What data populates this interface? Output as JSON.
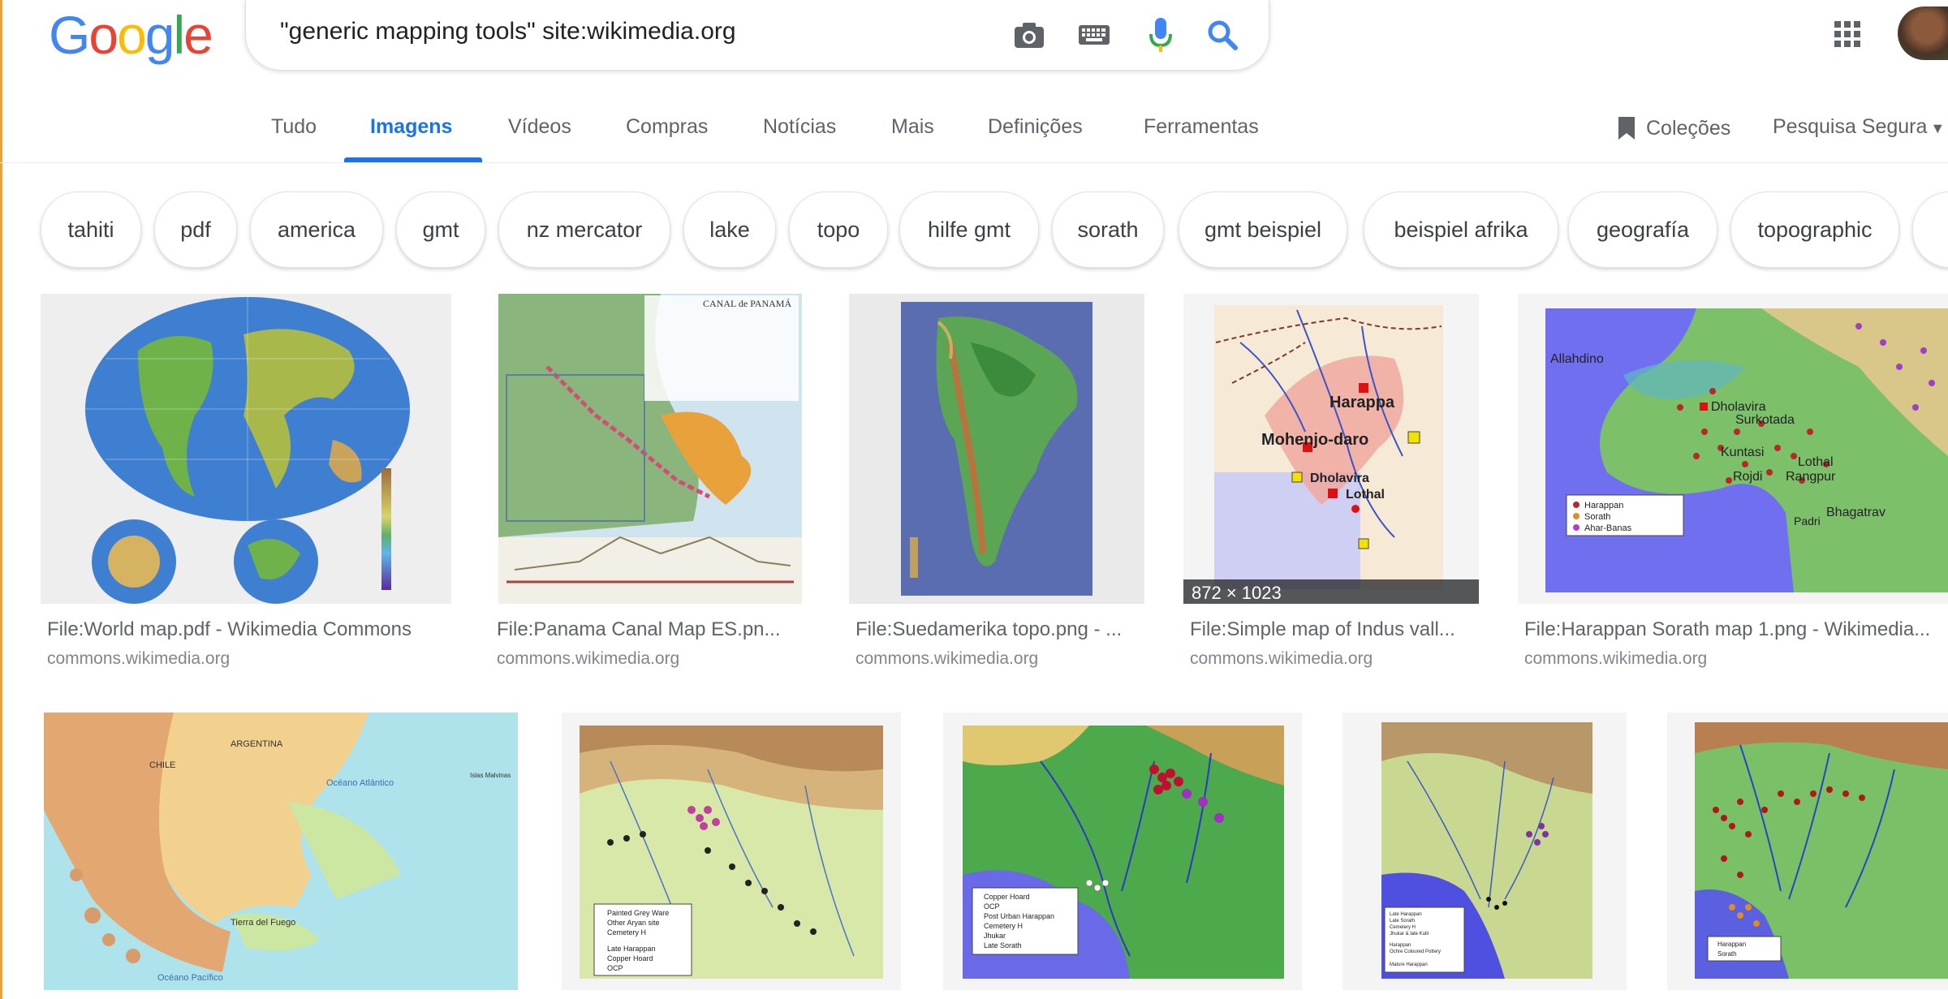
{
  "search": {
    "query": "\"generic mapping tools\" site:wikimedia.org"
  },
  "icons": {
    "camera": "camera-icon",
    "keyboard": "keyboard-icon",
    "mic": "mic-icon",
    "search": "search-icon",
    "apps": "apps-grid-icon",
    "bookmark": "bookmark-icon"
  },
  "tabs": [
    "Tudo",
    "Imagens",
    "Vídeos",
    "Compras",
    "Notícias",
    "Mais",
    "Definições",
    "Ferramentas"
  ],
  "tools": {
    "collections": "Coleções",
    "safesearch": "Pesquisa Segura"
  },
  "chips": [
    "tahiti",
    "pdf",
    "america",
    "gmt",
    "nz mercator",
    "lake",
    "topo",
    "hilfe gmt",
    "sorath",
    "gmt beispiel",
    "beispiel afrika",
    "geografía",
    "topographic"
  ],
  "results": [
    {
      "title": "File:World map.pdf - Wikimedia Commons",
      "site": "commons.wikimedia.org"
    },
    {
      "title": "File:Panama Canal Map ES.pn...",
      "site": "commons.wikimedia.org"
    },
    {
      "title": "File:Suedamerika topo.png - ...",
      "site": "commons.wikimedia.org"
    },
    {
      "title": "File:Simple map of Indus vall...",
      "site": "commons.wikimedia.org",
      "dimensions": "872 × 1023"
    },
    {
      "title": "File:Harappan Sorath map 1.png - Wikimedia...",
      "site": "commons.wikimedia.org"
    }
  ],
  "map_labels": {
    "panama_title": "CANAL de PANAMÁ",
    "indus": [
      "Harappa",
      "Mohenjo-daro",
      "Dholavira",
      "Lothal"
    ],
    "sorath": [
      "Allahdino",
      "Dholavira",
      "Surkotada",
      "Kuntasi",
      "Lothal",
      "Rojdi",
      "Rangpur",
      "Padri",
      "Bhagatrav"
    ],
    "sorath_legend": [
      "Harappan",
      "Sorath",
      "Ahar-Banas"
    ],
    "patagonia": [
      "ARGENTINA",
      "CHILE",
      "Océano Atlántico",
      "Islas Malvinas",
      "Tierra del Fuego",
      "Océano Pacífico"
    ],
    "legend_pgw": [
      "Painted Grey Ware",
      "Other Aryan site",
      "Cemetery H",
      "Late Harappan",
      "Copper Hoard",
      "OCP"
    ],
    "legend_ch": [
      "Copper Hoard",
      "OCP",
      "Post Urban Harappan",
      "Cemetery H",
      "Jhukar",
      "Late Sorath"
    ],
    "legend_lh": [
      "Late Harappan",
      "Late Sorath",
      "Cemetery H",
      "Jhukar & late Kulli",
      "Harappan",
      "Ochre Coloured Pottery",
      "Mature Harappan"
    ],
    "legend_hs": [
      "Harappan",
      "Sorath"
    ]
  }
}
